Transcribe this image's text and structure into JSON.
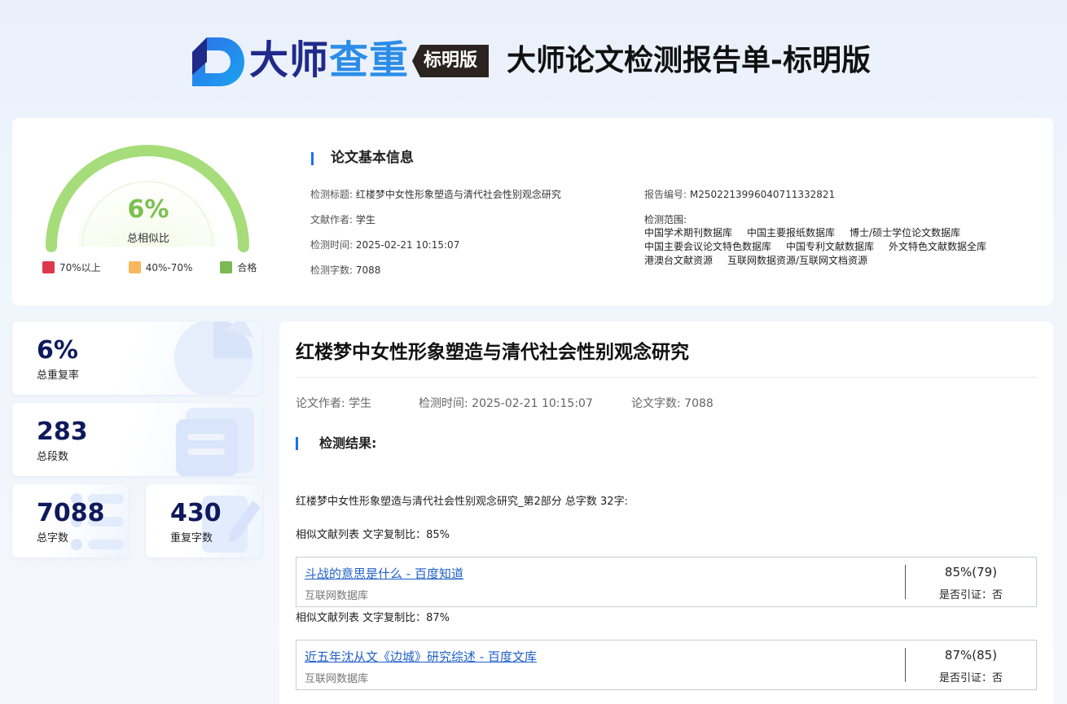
{
  "header": {
    "brand_part1": "大师",
    "brand_part2": "查重",
    "edition_badge": "标明版",
    "report_title": "大师论文检测报告单-标明版",
    "logo_icon": "brand-d-logo-icon",
    "colors": {
      "brand_dark": "#1f2a8a",
      "brand_light": "#2b8de8"
    }
  },
  "gauge": {
    "percent_text": "6%",
    "percent_value": 6,
    "label": "总相似比",
    "legend": [
      {
        "label": "70%以上",
        "color": "#dc3a4c"
      },
      {
        "label": "40%-70%",
        "color": "#f7b85c"
      },
      {
        "label": "合格",
        "color": "#7ab953"
      }
    ]
  },
  "info": {
    "heading": "论文基本信息",
    "title_label": "检测标题:",
    "title_value": "红楼梦中女性形象塑造与清代社会性别观念研究",
    "author_label": "文献作者:",
    "author_value": "学生",
    "time_label": "检测时间:",
    "time_value": "2025-02-21 10:15:07",
    "words_label": "检测字数:",
    "words_value": "7088",
    "report_no_label": "报告编号:",
    "report_no_value": "M2502213996040711332821",
    "scope_label": "检测范围:",
    "scope_rows": [
      [
        "中国学术期刊数据库",
        "中国主要报纸数据库",
        "博士/硕士学位论文数据库"
      ],
      [
        "中国主要会议论文特色数据库",
        "中国专利文献数据库",
        "外文特色文献数据全库"
      ],
      [
        "港澳台文献资源",
        "互联网数据资源/互联网文档资源"
      ]
    ]
  },
  "stats": [
    {
      "value": "6%",
      "label": "总重复率"
    },
    {
      "value": "283",
      "label": "总段数"
    },
    {
      "value": "7088",
      "label": "总字数"
    },
    {
      "value": "430",
      "label": "重复字数"
    }
  ],
  "main": {
    "title": "红楼梦中女性形象塑造与清代社会性别观念研究",
    "author": "论文作者: 学生",
    "time": "检测时间: 2025-02-21 10:15:07",
    "words": "论文字数: 7088",
    "result_heading": "检测结果:",
    "part_line": "红楼梦中女性形象塑造与清代社会性别观念研究_第2部分 总字数 32字:",
    "similar_lists": [
      {
        "caption": "相似文献列表 文字复制比：85%",
        "link": "斗战的意思是什么 - 百度知道",
        "source": "互联网数据库",
        "pct": "85%(79)",
        "cite": "是否引证：否"
      },
      {
        "caption": "相似文献列表 文字复制比：87%",
        "link": "近五年沈从文《边城》研究综述 - 百度文库",
        "source": "互联网数据库",
        "pct": "87%(85)",
        "cite": "是否引证：否"
      }
    ]
  }
}
